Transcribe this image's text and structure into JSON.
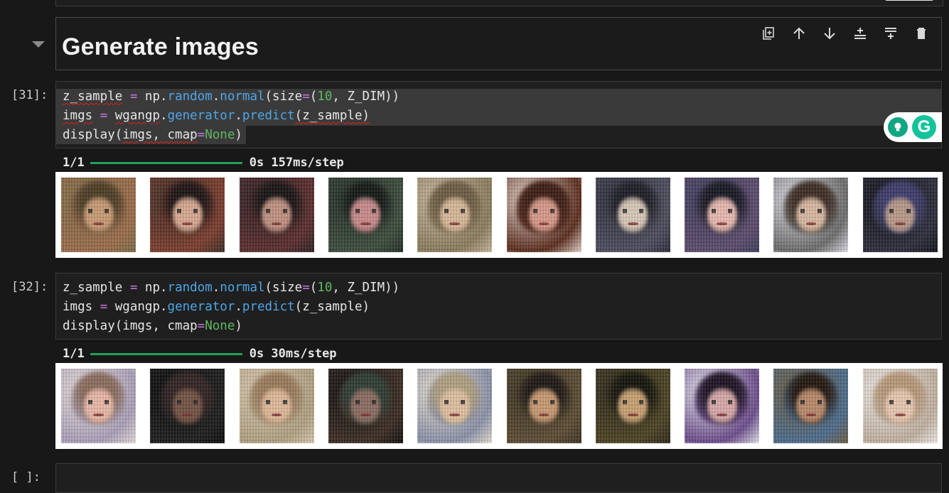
{
  "markdown": {
    "title": "Generate images"
  },
  "toolbar": {
    "buttons": [
      {
        "icon": "duplicate-cell-icon"
      },
      {
        "icon": "move-up-icon"
      },
      {
        "icon": "move-down-icon"
      },
      {
        "icon": "insert-above-icon"
      },
      {
        "icon": "insert-below-icon"
      },
      {
        "icon": "delete-cell-icon"
      }
    ]
  },
  "cells": [
    {
      "prompt": "[31]:",
      "progress": {
        "count": "1/1",
        "timing": "0s 157ms/step"
      }
    },
    {
      "prompt": "[32]:",
      "progress": {
        "count": "1/1",
        "timing": "0s 30ms/step"
      }
    }
  ],
  "code": {
    "line1": {
      "a": "z_sample",
      "b": " = ",
      "c": "np",
      "d": ".",
      "e": "random",
      "f": ".",
      "g": "normal",
      "h": "(size",
      "i": "=",
      "j": "(",
      "k": "10",
      "l": ", Z_DIM))"
    },
    "line2": {
      "a": "imgs",
      "b": " = ",
      "c": "wgangp",
      "d": ".",
      "e": "generator",
      "f": ".",
      "g": "predict",
      "h": "(z_sample)"
    },
    "line3": {
      "a": "display(",
      "b": "imgs",
      "c": ", cmap",
      "d": "=",
      "e": "None",
      "f": ")"
    }
  },
  "empty_prompt": "[ ]:",
  "colors": {
    "accent_green": "#21a05a",
    "keyword_purple": "#c678dd",
    "function_blue": "#4ea6e8",
    "number_green": "#5fb861"
  }
}
